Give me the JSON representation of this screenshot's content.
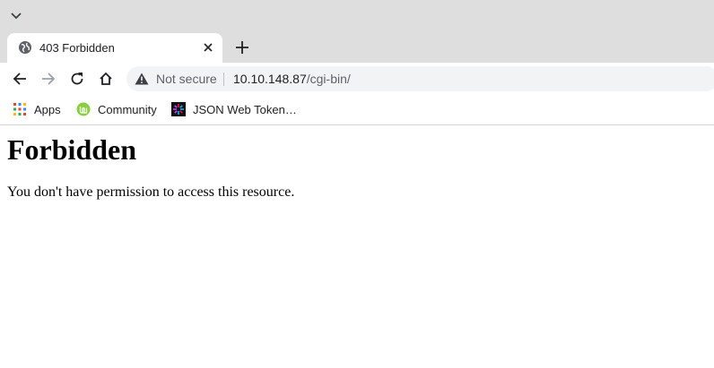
{
  "tab": {
    "title": "403 Forbidden"
  },
  "address_bar": {
    "security_label": "Not secure",
    "url_host": "10.10.148.87",
    "url_path": "/cgi-bin/"
  },
  "bookmarks": [
    {
      "label": "Apps",
      "icon": "apps-grid-icon"
    },
    {
      "label": "Community",
      "icon": "linux-mint-icon"
    },
    {
      "label": "JSON Web Token…",
      "icon": "jwt-icon"
    }
  ],
  "page": {
    "heading": "Forbidden",
    "message": "You don't have permission to access this resource."
  },
  "colors": {
    "chrome": "#dedede",
    "omnibox": "#f1f3f4",
    "text": "#202124"
  }
}
